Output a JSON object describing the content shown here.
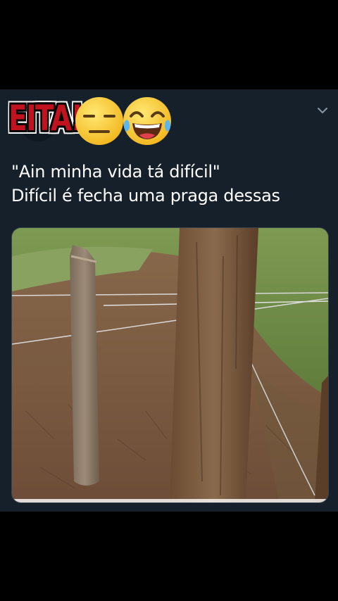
{
  "sticker": {
    "text": "EITA!"
  },
  "emojis": [
    "expressionless-face-icon",
    "face-with-tears-of-joy-icon"
  ],
  "tweet": {
    "lines": [
      "\"Ain minha vida tá difícil\"",
      "Difícil é fecha uma praga dessas"
    ]
  },
  "colors": {
    "background": "#000000",
    "card": "#15202b",
    "text": "#ffffff",
    "sticker_red": "#c1121f"
  }
}
